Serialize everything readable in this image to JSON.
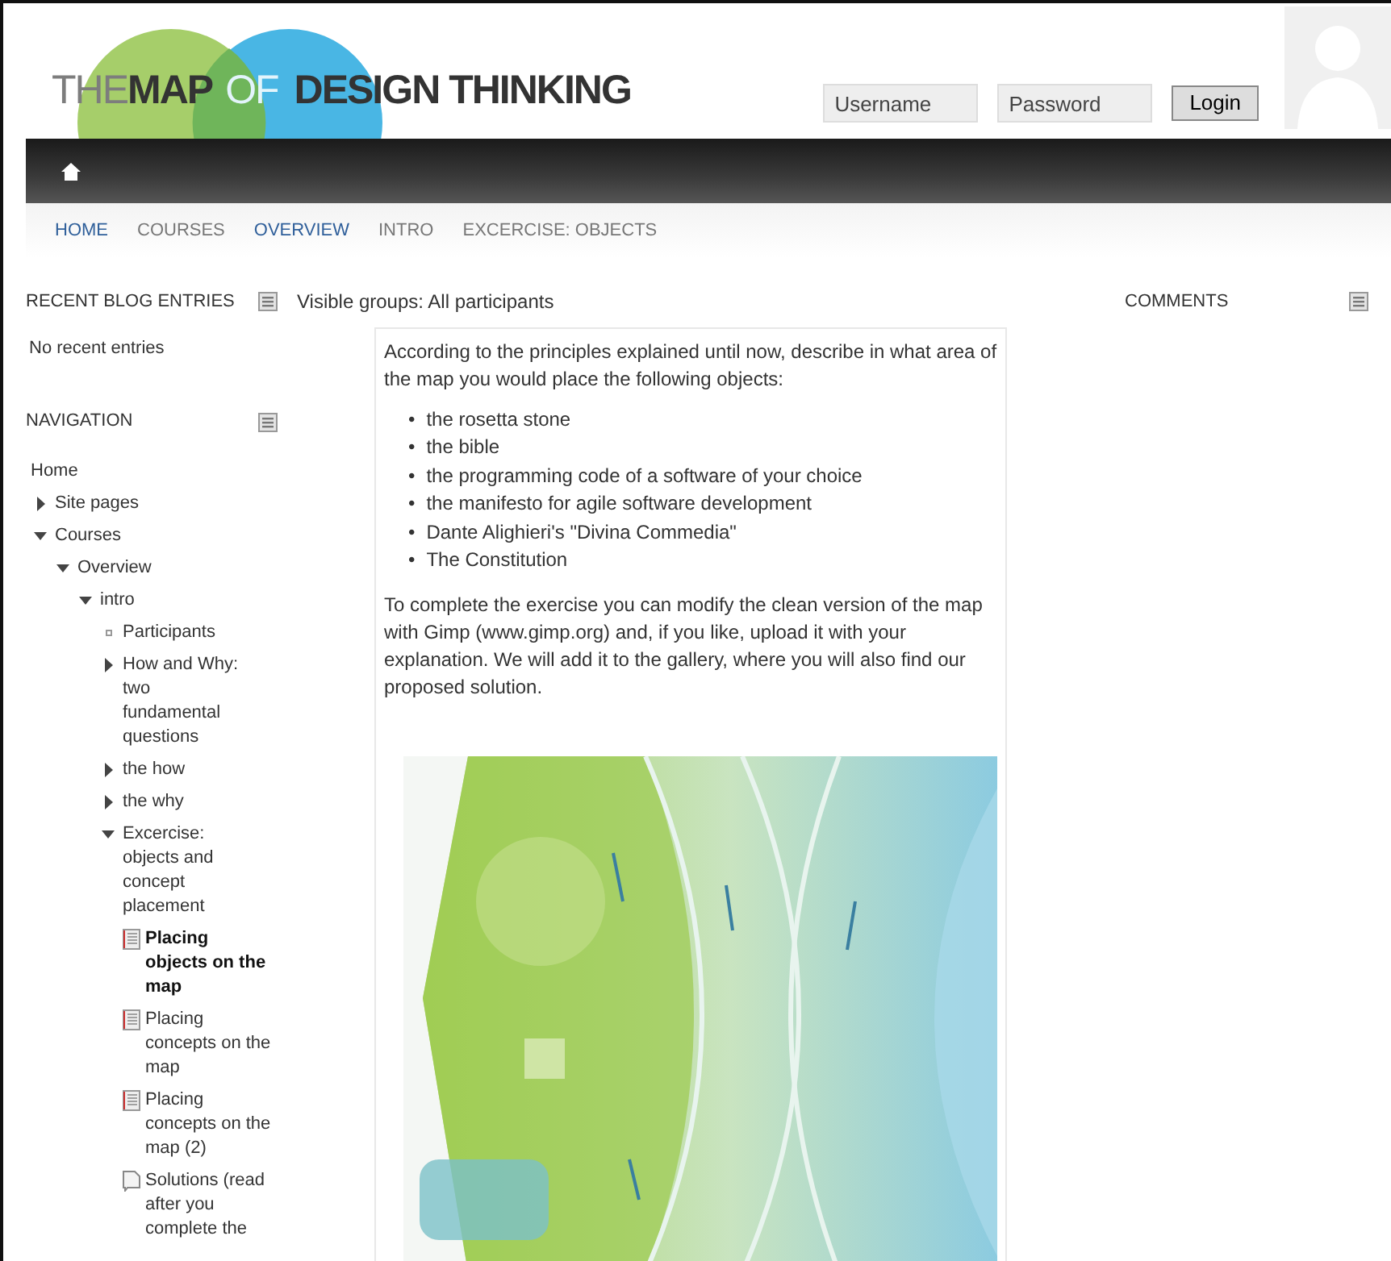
{
  "logo": {
    "parts": [
      "THE",
      "MAP",
      "OF",
      "DESIGN THINKING"
    ]
  },
  "login": {
    "username": {
      "placeholder": "Username"
    },
    "password": {
      "placeholder": "Password"
    },
    "button": "Login"
  },
  "breadcrumb": [
    {
      "label": "HOME",
      "visited": true
    },
    {
      "label": "COURSES",
      "visited": false
    },
    {
      "label": "OVERVIEW",
      "visited": true
    },
    {
      "label": "INTRO",
      "visited": false
    },
    {
      "label": "EXCERCISE: OBJECTS",
      "visited": false
    }
  ],
  "blocks_left": [
    {
      "title": "RECENT BLOG ENTRIES",
      "text": "No recent entries"
    },
    {
      "title": "NAVIGATION",
      "tree": [
        {
          "label": "Home",
          "kind": "link"
        },
        {
          "label": "Site pages",
          "kind": "branch",
          "expanded": false
        },
        {
          "label": "Courses",
          "kind": "branch",
          "expanded": true,
          "children": [
            {
              "label": "Overview",
              "kind": "branch",
              "expanded": true,
              "children": [
                {
                  "label": "intro",
                  "kind": "branch",
                  "expanded": true,
                  "children": [
                    {
                      "label": "Participants",
                      "kind": "item"
                    },
                    {
                      "label": "How and Why: two fundamental questions",
                      "kind": "branch",
                      "expanded": false
                    },
                    {
                      "label": "the how",
                      "kind": "branch",
                      "expanded": false
                    },
                    {
                      "label": "the why",
                      "kind": "branch",
                      "expanded": false
                    },
                    {
                      "label": "Excercise: objects and concept placement",
                      "kind": "branch",
                      "expanded": true,
                      "children": [
                        {
                          "label": "Placing objects on the map",
                          "kind": "page",
                          "selected": true
                        },
                        {
                          "label": "Placing concepts on the map",
                          "kind": "page",
                          "selected": false
                        },
                        {
                          "label": "Placing concepts on the map (2)",
                          "kind": "page",
                          "selected": false
                        },
                        {
                          "label": "Solutions (read after you complete the",
                          "kind": "file",
                          "selected": false
                        }
                      ]
                    }
                  ]
                }
              ]
            }
          ]
        }
      ]
    }
  ],
  "main": {
    "groups": "Visible groups: All participants",
    "intro": "According to the principles explained until now, describe in what area of the map you would place the following objects:",
    "bullet": "•",
    "objects": [
      "the rosetta stone",
      "the bible",
      "the programming code of a software of your choice",
      "the manifesto for agile software development",
      "Dante Alighieri's \"Divina Commedia\"",
      "The Constitution"
    ],
    "outro": "To complete the exercise you can modify the clean version of the map with Gimp (www.gimp.org) and, if you like, upload it with your explanation. We will add it to the gallery, where you will also find our proposed solution."
  },
  "blocks_right": [
    {
      "title": "COMMENTS"
    }
  ]
}
